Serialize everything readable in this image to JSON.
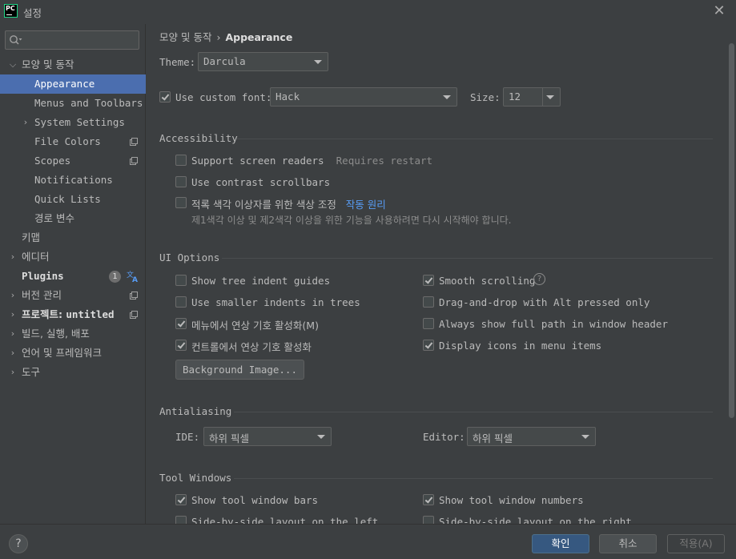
{
  "window": {
    "title": "설정",
    "logo_text": "PC"
  },
  "search": {
    "placeholder": "",
    "value": ""
  },
  "sidebar": {
    "items": [
      {
        "label": "모양 및 동작",
        "arrow": "v"
      },
      {
        "label": "Appearance"
      },
      {
        "label": "Menus and Toolbars"
      },
      {
        "label": "System Settings",
        "arrow": ">"
      },
      {
        "label": "File Colors"
      },
      {
        "label": "Scopes"
      },
      {
        "label": "Notifications"
      },
      {
        "label": "Quick Lists"
      },
      {
        "label": "경로 변수"
      },
      {
        "label": "키맵"
      },
      {
        "label": "에디터",
        "arrow": ">"
      },
      {
        "label": "Plugins",
        "badge": "1"
      },
      {
        "label": "버전 관리",
        "arrow": ">"
      },
      {
        "label": "프로젝트: ",
        "label_bold": "untitled",
        "arrow": ">"
      },
      {
        "label": "빌드, 실행, 배포",
        "arrow": ">"
      },
      {
        "label": "언어 및 프레임워크",
        "arrow": ">"
      },
      {
        "label": "도구",
        "arrow": ">"
      }
    ]
  },
  "breadcrumb": {
    "parent": "모양 및 동작",
    "separator": "›",
    "current": "Appearance"
  },
  "theme": {
    "label": "Theme:",
    "value": "Darcula"
  },
  "font": {
    "checkbox_label": "Use custom font:",
    "checked": true,
    "value": "Hack",
    "size_label": "Size:",
    "size_value": "12"
  },
  "accessibility": {
    "title": "Accessibility",
    "screen_readers": {
      "label": "Support screen readers",
      "hint": "Requires restart",
      "checked": false
    },
    "contrast_scrollbars": {
      "label": "Use contrast scrollbars",
      "checked": false
    },
    "color_blind": {
      "label": "적록 색각 이상자를 위한 색상 조정",
      "link": "작동 원리",
      "checked": false,
      "hint": "제1색각 이상 및 제2색각 이상을 위한 기능을 사용하려면 다시 시작해야 합니다."
    }
  },
  "ui_options": {
    "title": "UI Options",
    "left": [
      {
        "label": "Show tree indent guides",
        "checked": false
      },
      {
        "label": "Use smaller indents in trees",
        "checked": false
      },
      {
        "label": "메뉴에서 연상 기호 활성화(M)",
        "checked": true
      },
      {
        "label": "컨트롤에서 연상 기호 활성화",
        "checked": true
      }
    ],
    "right": [
      {
        "label": "Smooth scrolling",
        "checked": true
      },
      {
        "label": "Drag-and-drop with Alt pressed only",
        "checked": false
      },
      {
        "label": "Always show full path in window header",
        "checked": false
      },
      {
        "label": "Display icons in menu items",
        "checked": true
      }
    ],
    "help_glyph": "?",
    "background_button": "Background Image..."
  },
  "antialiasing": {
    "title": "Antialiasing",
    "ide_label": "IDE:",
    "ide_value": "하위 픽셀",
    "editor_label": "Editor:",
    "editor_value": "하위 픽셀"
  },
  "tool_windows": {
    "title": "Tool Windows",
    "left": [
      {
        "label": "Show tool window bars",
        "checked": true
      },
      {
        "label": "Side-by-side layout on the left",
        "checked": false
      }
    ],
    "right": [
      {
        "label": "Show tool window numbers",
        "checked": true
      },
      {
        "label": "Side-by-side layout on the right",
        "checked": false
      }
    ]
  },
  "footer": {
    "help": "?",
    "ok": "확인",
    "cancel": "취소",
    "apply": "적용(A)"
  },
  "colors": {
    "accent": "#4b6eaf",
    "link": "#589df6",
    "background": "#3c3f41",
    "ok_button": "#365880"
  }
}
